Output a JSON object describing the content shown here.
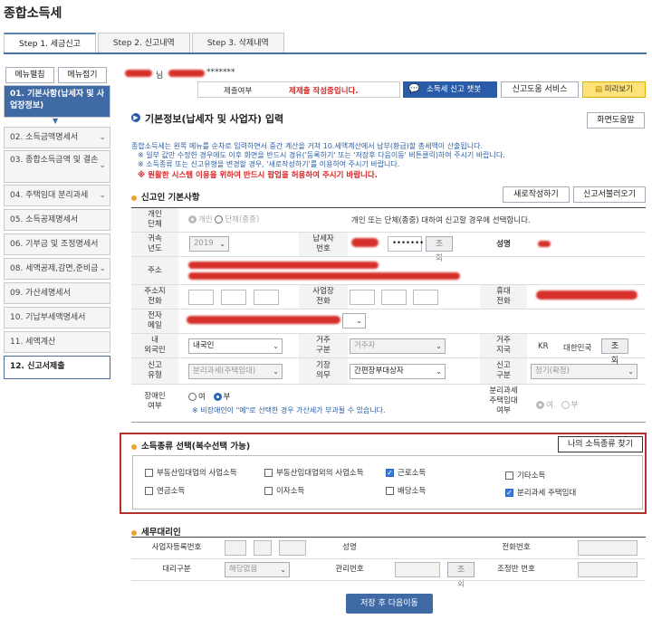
{
  "page_title": "종합소득세",
  "tabs": [
    "Step 1. 세금신고",
    "Step 2. 신고내역",
    "Step 3. 삭제내역"
  ],
  "side": {
    "menu_settings": "메뉴펼침",
    "menu_collapse": "메뉴접기",
    "items": [
      "01. 기본사항(납세자 및 사업장정보)",
      "02. 소득금액명세서",
      "03. 종합소득금액 및 결손",
      "04. 주택임대 분리과세",
      "05. 소득공제명세서",
      "06. 기부금 및 조정명세서",
      "08. 세액공제,감면,준비금",
      "09. 가산세명세서",
      "10. 기납부세액명세서",
      "11. 세액계산",
      "12. 신고서제출"
    ]
  },
  "top": {
    "name_suffix": "님",
    "masked": "*******",
    "status_label": "제출여부",
    "status_value": "제제출 작성중입니다.",
    "chatbot": "소득세 신고 챗봇",
    "service": "신고도움 서비스",
    "preview": "미리보기"
  },
  "main": {
    "heading": "기본정보(납세자 및 사업자) 입력",
    "help": "화면도움말",
    "note1": "종합소득세는 왼쪽 메뉴를 순차로 입력하면서 중간 계산을 거쳐 10.세액계산에서 납부(환급)할 총세액이 산출됩니다.",
    "note2": "※ 일부 값만 수정한 경우에도 이후 화면을 반드시 경유('등록하기' 또는 '저장후 다음이동' 버튼클릭)하여 주시기 바랍니다.",
    "note3": "※ 소득종류 또는 신고유형을 변경할 경우, '새로작성하기'를 이용하여 주시기 바랍니다.",
    "note4": "※ 원활한 시스템 이용을 위하여 반드시 팝업을 허용하여 주시기 바랍니다."
  },
  "basic": {
    "title": "신고인 기본사항",
    "new_btn": "새로작성하기",
    "load_btn": "신고서불러오기",
    "individual_label": "개인\n단체",
    "opt_individual": "개인",
    "opt_group": "단체(종중)",
    "individual_hint": "개인 또는 단체(종중) 대하여 신고할 경우에 선택합니다.",
    "year_label": "귀속\n년도",
    "year_value": "2019",
    "taxpayer_no_label": "납세자\n번호",
    "masked_no": "•••••••",
    "lookup": "조회",
    "name_label": "성명",
    "address_label": "주소",
    "addr_phone_label": "주소지\n전화",
    "biz_phone_label": "사업장\n전화",
    "mobile_label": "휴대\n전화",
    "email_label": "전자\n메일",
    "nationality_label": "내\n외국인",
    "nationality_value": "내국인",
    "residence_label": "거주\n구분",
    "residence_value": "거주자",
    "country_label": "거주\n지국",
    "country_code": "KR",
    "country_name": "대한민국",
    "report_type_label": "신고\n유형",
    "report_type_value": "분리과세(주택임대)",
    "ledger_label": "기장\n의무",
    "ledger_value": "간편장부대상자",
    "report_class_label": "신고\n구분",
    "report_class_value": "정기(확정)",
    "disabled_label": "장애인\n여부",
    "yes": "여",
    "no": "부",
    "disabled_note": "※ 비장애인이 \"예\"로 선택한 경우 가산세가 부과될 수 있습니다.",
    "separate_rental_label": "분리과세\n주택임대\n여부"
  },
  "income": {
    "title": "소득종류 선택(복수선택 가능)",
    "find_btn": "나의 소득종류 찾기",
    "items": [
      {
        "label": "부동산임대업의 사업소득",
        "checked": false
      },
      {
        "label": "부동산임대업외의 사업소득",
        "checked": false
      },
      {
        "label": "근로소득",
        "checked": true
      },
      {
        "label": "기타소득",
        "checked": false
      },
      {
        "label": "연금소득",
        "checked": false
      },
      {
        "label": "이자소득",
        "checked": false
      },
      {
        "label": "배당소득",
        "checked": false
      },
      {
        "label": "분리과세 주택임대",
        "checked": true
      }
    ]
  },
  "agent": {
    "title": "세무대리인",
    "bizno_label": "사업자등록번호",
    "name_label": "성명",
    "phone_label": "전화번호",
    "type_label": "대리구분",
    "type_value": "해당없음",
    "mgmt_label": "관리번호",
    "lookup": "조회",
    "adjust_label": "조정반 번호"
  },
  "footer": {
    "save_next": "저장 후 다음이동"
  },
  "colors": {
    "accent": "#3f6aa6",
    "highlight_border": "#b5302a"
  }
}
